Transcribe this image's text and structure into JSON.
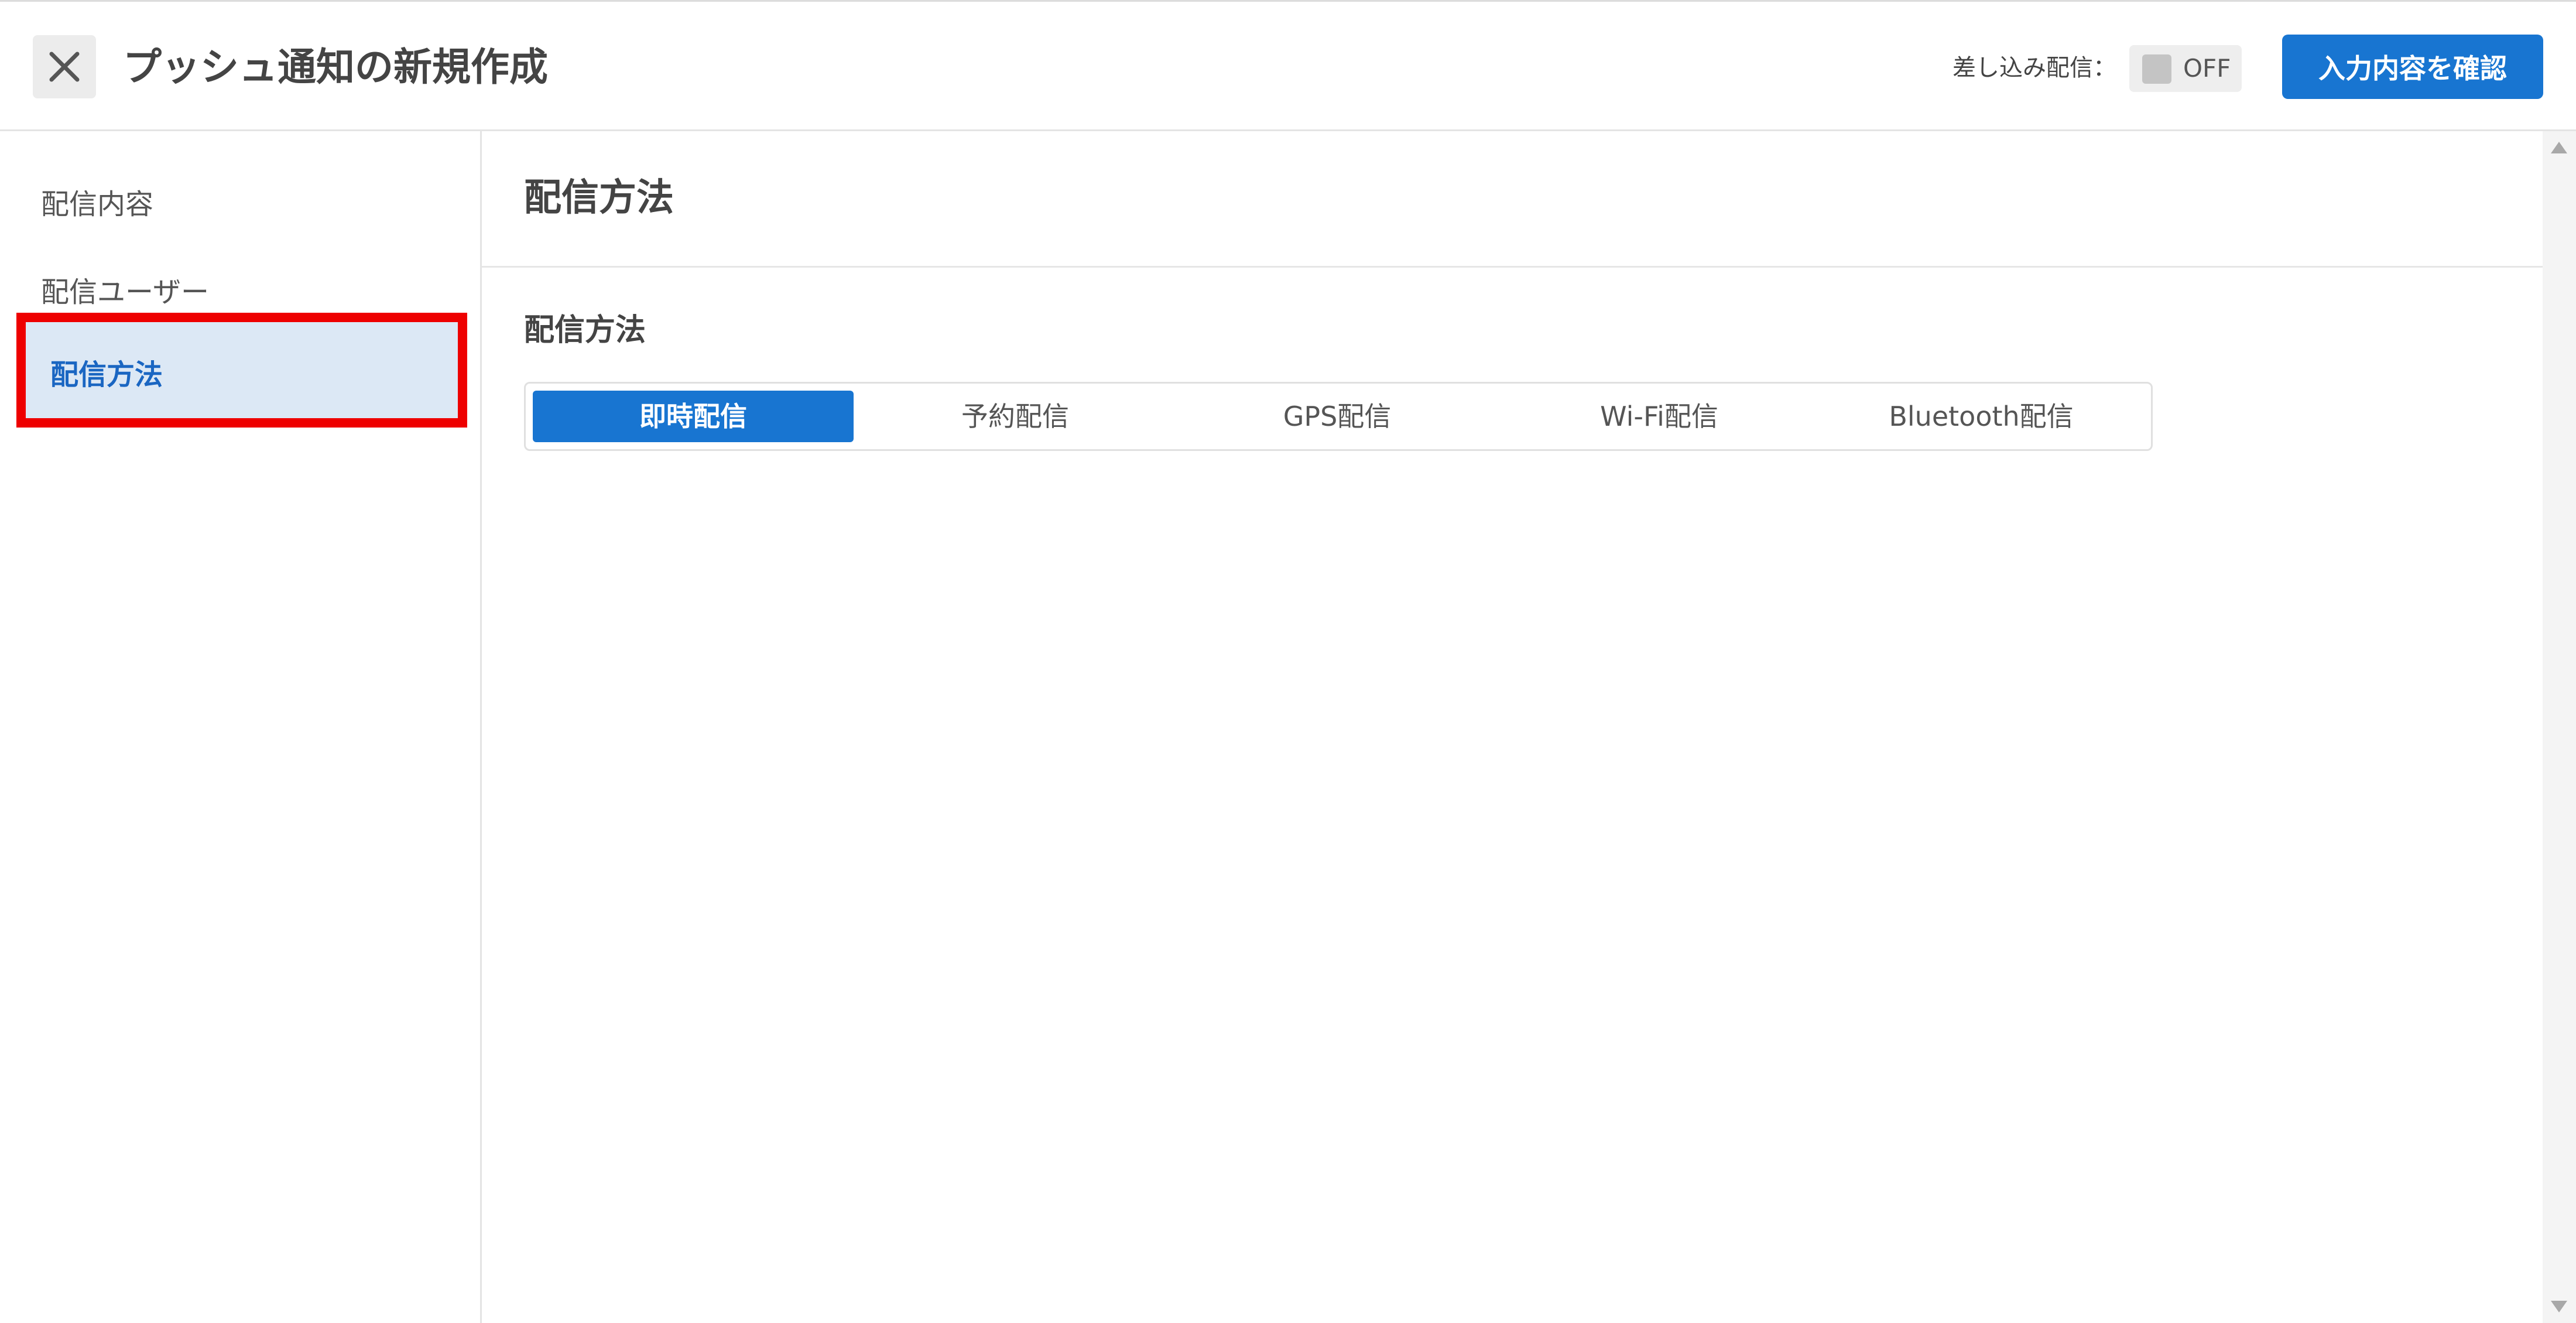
{
  "header": {
    "title": "プッシュ通知の新規作成",
    "merge_label": "差し込み配信：",
    "merge_toggle": {
      "state_label": "OFF",
      "on": false
    },
    "confirm_label": "入力内容を確認",
    "close_icon": "close-icon"
  },
  "sidebar": {
    "items": [
      {
        "label": "配信内容",
        "active": false
      },
      {
        "label": "配信ユーザー",
        "active": false
      },
      {
        "label": "配信方法",
        "active": true
      }
    ]
  },
  "main": {
    "title": "配信方法",
    "section_label": "配信方法",
    "methods": [
      {
        "label": "即時配信",
        "selected": true
      },
      {
        "label": "予約配信",
        "selected": false
      },
      {
        "label": "GPS配信",
        "selected": false
      },
      {
        "label": "Wi-Fi配信",
        "selected": false
      },
      {
        "label": "Bluetooth配信",
        "selected": false
      }
    ]
  },
  "colors": {
    "accent": "#1875d1",
    "active_bg": "#dce8f5",
    "highlight_border": "#ee0000"
  }
}
